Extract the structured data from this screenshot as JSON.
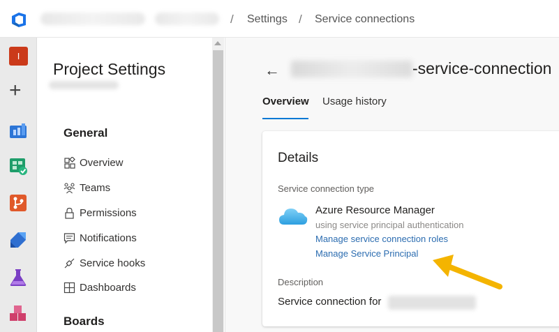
{
  "topbar": {
    "breadcrumb_settings": "Settings",
    "breadcrumb_service_connections": "Service connections",
    "separator": "/"
  },
  "rail": {
    "avatar_letter": "I",
    "icons": [
      "azure-devops-logo",
      "new-project-plus",
      "overview-icon",
      "boards-icon",
      "repos-icon",
      "pipelines-icon",
      "test-plans-icon",
      "artifacts-icon"
    ]
  },
  "settings": {
    "title": "Project Settings",
    "general_heading": "General",
    "items": [
      {
        "label": "Overview",
        "icon": "overview-icon"
      },
      {
        "label": "Teams",
        "icon": "teams-icon"
      },
      {
        "label": "Permissions",
        "icon": "lock-icon"
      },
      {
        "label": "Notifications",
        "icon": "notifications-icon"
      },
      {
        "label": "Service hooks",
        "icon": "service-hooks-icon"
      },
      {
        "label": "Dashboards",
        "icon": "dashboards-icon"
      }
    ],
    "boards_heading": "Boards"
  },
  "main": {
    "title_suffix": "-service-connection",
    "tabs": [
      {
        "label": "Overview",
        "active": true
      },
      {
        "label": "Usage history",
        "active": false
      }
    ],
    "details": {
      "title": "Details",
      "type_label": "Service connection type",
      "service_name": "Azure Resource Manager",
      "service_auth": "using service principal authentication",
      "link_roles": "Manage service connection roles",
      "link_principal": "Manage Service Principal",
      "description_label": "Description",
      "description_prefix": "Service connection for"
    }
  },
  "colors": {
    "accent": "#0078d4",
    "link": "#2b6cb0",
    "arrow": "#f4b400"
  }
}
